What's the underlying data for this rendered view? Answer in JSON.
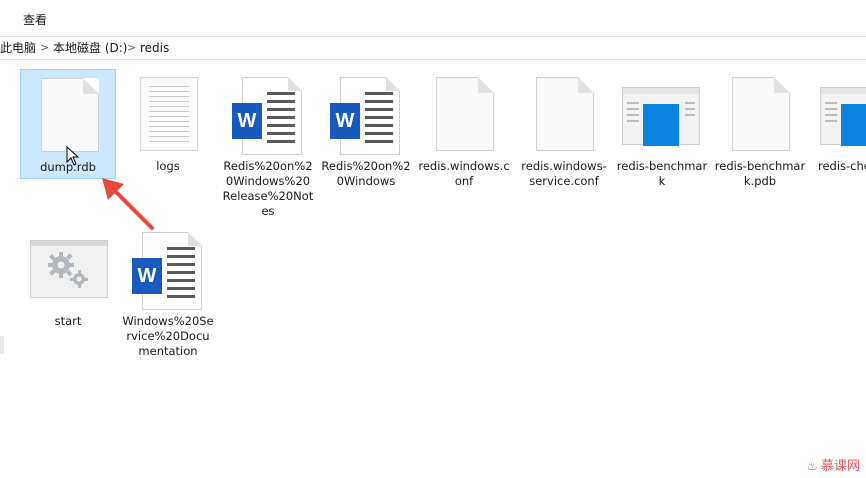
{
  "ribbon": {
    "tab_view": "查看"
  },
  "address": {
    "crumbs": [
      "此电脑",
      "本地磁盘 (D:)",
      "redis"
    ],
    "separator": ">"
  },
  "files": [
    {
      "name_lines": [
        "dump.rdb"
      ],
      "type": "blank-page",
      "selected": true
    },
    {
      "name_lines": [
        "logs"
      ],
      "type": "text-lines"
    },
    {
      "name_lines": [
        "Redis%20on%2",
        "0Windows%20",
        "Release%20Not",
        "es"
      ],
      "type": "word-doc"
    },
    {
      "name_lines": [
        "Redis%20on%2",
        "0Windows"
      ],
      "type": "word-doc"
    },
    {
      "name_lines": [
        "redis.windows.c",
        "onf"
      ],
      "type": "blank-page"
    },
    {
      "name_lines": [
        "redis.windows-",
        "service.conf"
      ],
      "type": "blank-page"
    },
    {
      "name_lines": [
        "redis-benchmar",
        "k"
      ],
      "type": "app-window"
    },
    {
      "name_lines": [
        "redis-benchmar",
        "k.pdb"
      ],
      "type": "blank-page"
    },
    {
      "name_lines": [
        "redis-che"
      ],
      "type": "app-window"
    },
    {
      "name_lines": [
        "start"
      ],
      "type": "gear-window"
    },
    {
      "name_lines": [
        "Windows%20Se",
        "rvice%20Docu",
        "mentation"
      ],
      "type": "word-doc"
    }
  ],
  "icons": {
    "word_badge": "W",
    "word_color": "#185abd",
    "app_blue": "#0a84e0",
    "selection_bg": "#cce8ff",
    "arrow_color": "#e8473c"
  },
  "watermark": "慕课网"
}
